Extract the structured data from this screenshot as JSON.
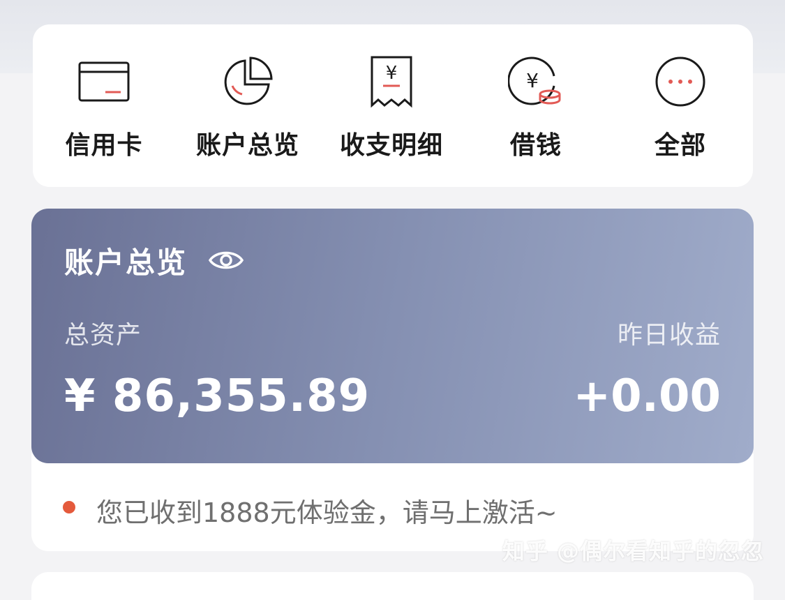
{
  "quick_actions": [
    {
      "label": "信用卡",
      "icon": "credit-card-icon"
    },
    {
      "label": "账户总览",
      "icon": "pie-chart-icon"
    },
    {
      "label": "收支明细",
      "icon": "receipt-icon"
    },
    {
      "label": "借钱",
      "icon": "yuan-coins-icon"
    },
    {
      "label": "全部",
      "icon": "more-icon"
    }
  ],
  "overview": {
    "title": "账户总览",
    "total_assets_label": "总资产",
    "total_assets_value": "¥ 86,355.89",
    "yesterday_earnings_label": "昨日收益",
    "yesterday_earnings_value": "+0.00"
  },
  "notice": {
    "text": "您已收到1888元体验金，请马上激活~"
  },
  "watermark": "知乎 @偶尔看知乎的忽忽",
  "colors": {
    "accent": "#e45a3c",
    "card_gradient_start": "#6a7195",
    "card_gradient_end": "#a0acca"
  }
}
